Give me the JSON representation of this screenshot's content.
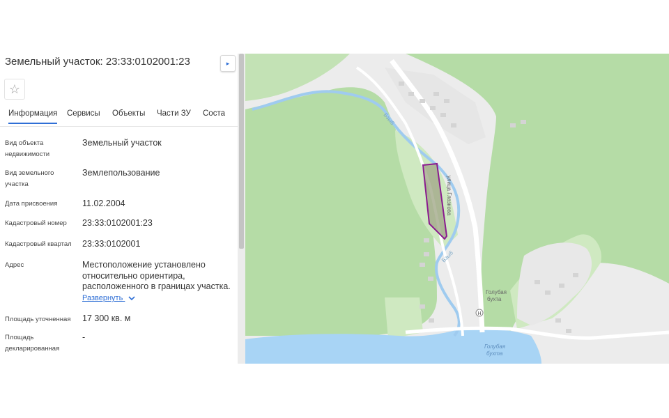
{
  "panel": {
    "title": "Земельный участок: 23:33:0102001:23",
    "star_icon": "☆",
    "tabs": [
      "Информация",
      "Сервисы",
      "Объекты",
      "Части ЗУ",
      "Соста"
    ],
    "active_tab": "Информация",
    "tab_scroll_icon": "▸",
    "fields": [
      {
        "label": "Вид объекта недвижимости",
        "value": "Земельный участок"
      },
      {
        "label": "Вид земельного участка",
        "value": "Землепользование"
      },
      {
        "label": "Дата присвоения",
        "value": "11.02.2004"
      },
      {
        "label": "Кадастровый номер",
        "value": "23:33:0102001:23"
      },
      {
        "label": "Кадастровый квартал",
        "value": "23:33:0102001"
      },
      {
        "label": "Адрес",
        "value": "Местоположение установлено относительно ориентира, расположенного в границах участка."
      },
      {
        "label": "Площадь уточненная",
        "value": "17 300 кв. м"
      },
      {
        "label": "Площадь декларированная",
        "value": "-"
      }
    ],
    "expand_label": "Развернуть",
    "expand_icon": "chevron-down-icon"
  },
  "map": {
    "labels": {
      "river_1": "Бзыб",
      "street": "улица Глазкова",
      "river_2": "Бзыб",
      "place": "Голубая бухта",
      "bay": "Голубая бухта",
      "hospital_icon": "H"
    },
    "colors": {
      "forest": "#b5dca6",
      "grass": "#cfe9c1",
      "water": "#a8d4f5",
      "river": "#9fcbef",
      "road": "#ffffff",
      "parcel_border": "#8a1a8f",
      "parcel_fill": "#a3a98a"
    }
  }
}
